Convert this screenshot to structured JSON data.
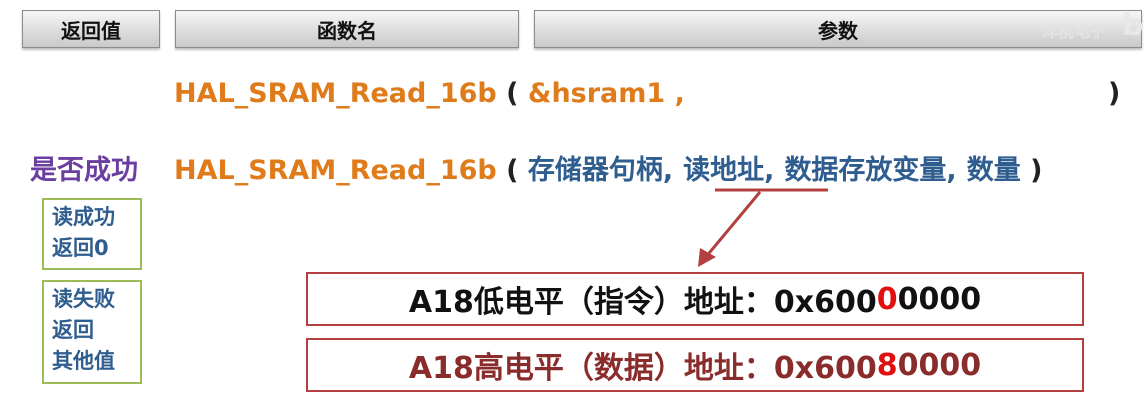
{
  "headers": {
    "return_value": "返回值",
    "function_name": "函数名",
    "parameters": "参数"
  },
  "watermark": {
    "text": "洋桃电子",
    "glyph": "b"
  },
  "line1": {
    "function": "HAL_SRAM_Read_16b",
    "open_paren": "(",
    "arg": "&hsram1 ,",
    "close_paren": ")"
  },
  "line2": {
    "return_label": "是否成功",
    "function": "HAL_SRAM_Read_16b",
    "open_paren": "(",
    "arg1": "存储器句柄,",
    "arg2": "读地址,",
    "arg3": "数据存放变量,",
    "arg4": "数量",
    "close_paren": ")"
  },
  "status": {
    "success": [
      "读成功",
      "返回0"
    ],
    "failure": [
      "读失败",
      "返回",
      "其他值"
    ]
  },
  "address_boxes": {
    "low": {
      "prefix": "A18低电平（指令）地址：0x600",
      "highlight": "0",
      "suffix": "0000"
    },
    "high": {
      "prefix": "A18高电平（数据）地址：0x600",
      "highlight": "8",
      "suffix": "0000"
    }
  },
  "colors": {
    "orange": "#e07b1b",
    "blue": "#2f5d8f",
    "purple": "#6b3fa0",
    "green_border": "#9bbb59",
    "red_border": "#b24040",
    "highlight_red": "#e01010"
  }
}
